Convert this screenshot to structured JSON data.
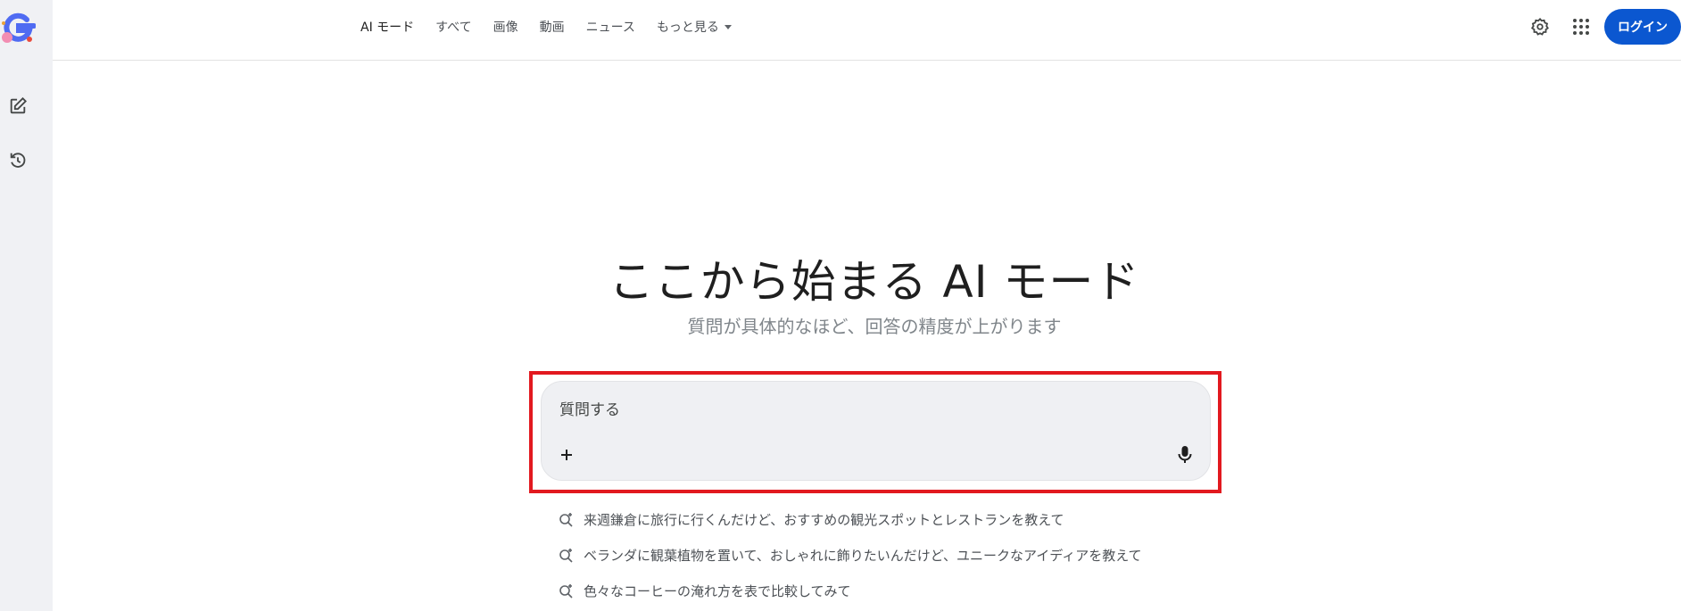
{
  "nav": {
    "items": [
      {
        "label": "AI モード",
        "active": true
      },
      {
        "label": "すべて"
      },
      {
        "label": "画像"
      },
      {
        "label": "動画"
      },
      {
        "label": "ニュース"
      },
      {
        "label": "もっと見る"
      }
    ]
  },
  "header": {
    "login_label": "ログイン",
    "icons": [
      "gear-icon",
      "apps-grid-icon"
    ]
  },
  "sidebar": {
    "icons": [
      "logo-icon",
      "new-chat-icon",
      "history-icon"
    ]
  },
  "main": {
    "title": "ここから始まる AI モード",
    "subtitle": "質問が具体的なほど、回答の精度が上がります",
    "search": {
      "placeholder": "質問する"
    },
    "suggestions": [
      "来週鎌倉に旅行に行くんだけど、おすすめの観光スポットとレストランを教えて",
      "ベランダに観葉植物を置いて、おしゃれに飾りたいんだけど、ユニークなアイディアを教えて",
      "色々なコーヒーの淹れ方を表で比較してみて"
    ]
  },
  "colors": {
    "accent": "#0b57d0",
    "highlight": "#e2191f",
    "rail_bg": "#f0f1f4",
    "search_bg": "#eff0f3"
  }
}
